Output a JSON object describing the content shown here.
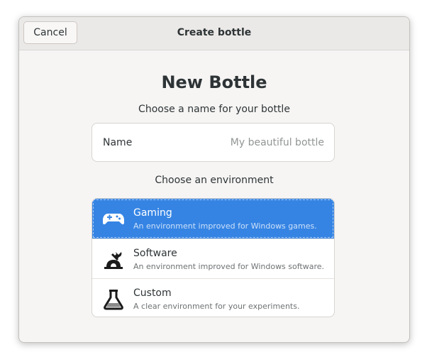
{
  "header": {
    "cancel_label": "Cancel",
    "title": "Create bottle"
  },
  "main": {
    "title": "New Bottle",
    "name_prompt": "Choose a name for your bottle",
    "name_field": {
      "label": "Name",
      "value": "",
      "placeholder": "My beautiful bottle"
    },
    "env_prompt": "Choose an environment",
    "environments": [
      {
        "title": "Gaming",
        "description": "An environment improved for Windows games.",
        "icon": "gamepad-icon",
        "selected": true
      },
      {
        "title": "Software",
        "description": "An environment improved for Windows software.",
        "icon": "software-icon",
        "selected": false
      },
      {
        "title": "Custom",
        "description": "A clear environment for your experiments.",
        "icon": "flask-icon",
        "selected": false
      }
    ]
  },
  "colors": {
    "accent": "#3584e4",
    "window_bg": "#f6f5f4",
    "headerbar_bg": "#ebe9e7"
  }
}
